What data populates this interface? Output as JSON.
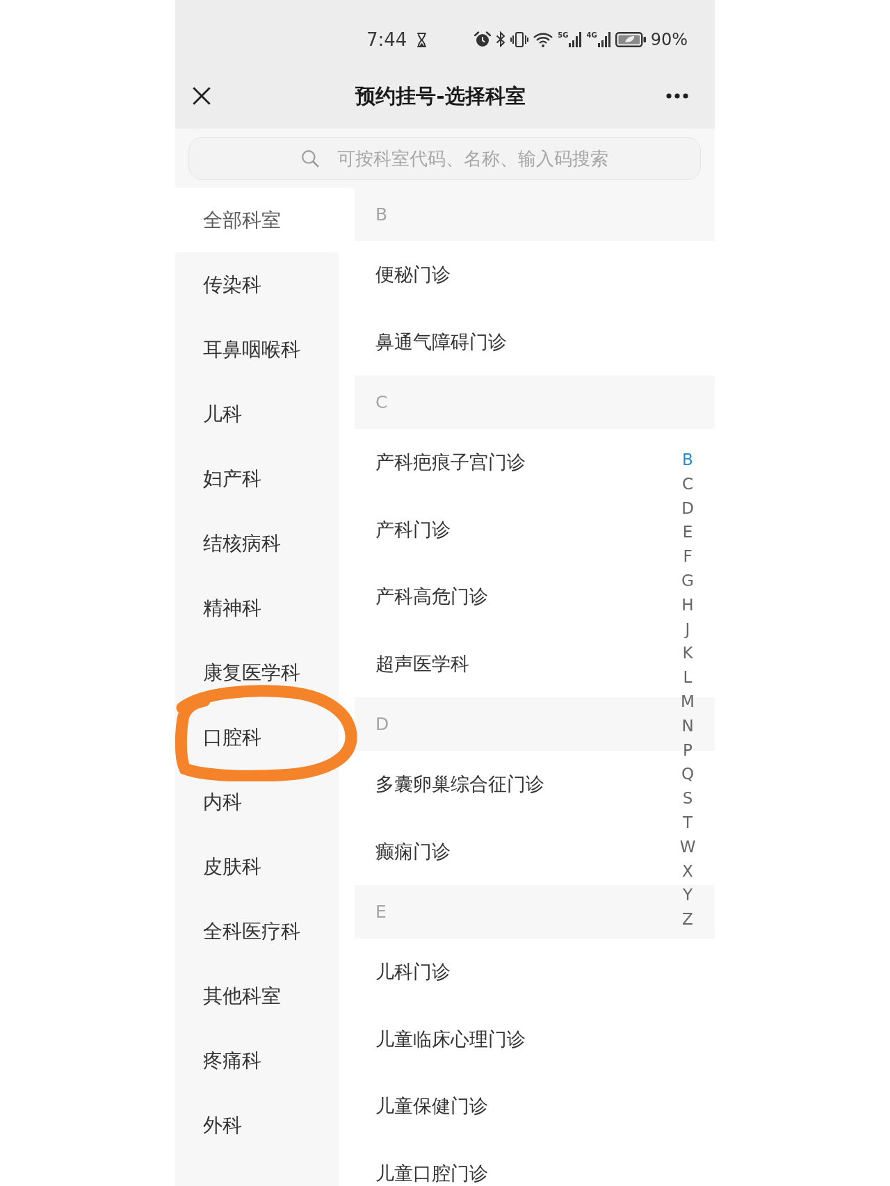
{
  "status_bar": {
    "time": "7:44",
    "signals": [
      {
        "label": "5G"
      },
      {
        "label": "4G"
      }
    ],
    "battery": "90%"
  },
  "header": {
    "title": "预约挂号-选择科室"
  },
  "search": {
    "placeholder": "可按科室代码、名称、输入码搜索"
  },
  "categories": [
    {
      "label": "全部科室",
      "selected": true,
      "circled": false
    },
    {
      "label": "传染科",
      "selected": false,
      "circled": false
    },
    {
      "label": "耳鼻咽喉科",
      "selected": false,
      "circled": false
    },
    {
      "label": "儿科",
      "selected": false,
      "circled": false
    },
    {
      "label": "妇产科",
      "selected": false,
      "circled": false
    },
    {
      "label": "结核病科",
      "selected": false,
      "circled": false
    },
    {
      "label": "精神科",
      "selected": false,
      "circled": false
    },
    {
      "label": "康复医学科",
      "selected": false,
      "circled": false
    },
    {
      "label": "口腔科",
      "selected": false,
      "circled": true
    },
    {
      "label": "内科",
      "selected": false,
      "circled": false
    },
    {
      "label": "皮肤科",
      "selected": false,
      "circled": false
    },
    {
      "label": "全科医疗科",
      "selected": false,
      "circled": false
    },
    {
      "label": "其他科室",
      "selected": false,
      "circled": false
    },
    {
      "label": "疼痛科",
      "selected": false,
      "circled": false
    },
    {
      "label": "外科",
      "selected": false,
      "circled": false
    }
  ],
  "sections": [
    {
      "letter": "B",
      "items": [
        "便秘门诊",
        "鼻通气障碍门诊"
      ]
    },
    {
      "letter": "C",
      "items": [
        "产科疤痕子宫门诊",
        "产科门诊",
        "产科高危门诊",
        "超声医学科"
      ]
    },
    {
      "letter": "D",
      "items": [
        "多囊卵巢综合征门诊",
        "癫痫门诊"
      ]
    },
    {
      "letter": "E",
      "items": [
        "儿科门诊",
        "儿童临床心理门诊",
        "儿童保健门诊",
        "儿童口腔门诊"
      ]
    }
  ],
  "index": [
    {
      "letter": "B",
      "selected": true
    },
    {
      "letter": "C",
      "selected": false
    },
    {
      "letter": "D",
      "selected": false
    },
    {
      "letter": "E",
      "selected": false
    },
    {
      "letter": "F",
      "selected": false
    },
    {
      "letter": "G",
      "selected": false
    },
    {
      "letter": "H",
      "selected": false
    },
    {
      "letter": "J",
      "selected": false
    },
    {
      "letter": "K",
      "selected": false
    },
    {
      "letter": "L",
      "selected": false
    },
    {
      "letter": "M",
      "selected": false
    },
    {
      "letter": "N",
      "selected": false
    },
    {
      "letter": "P",
      "selected": false
    },
    {
      "letter": "Q",
      "selected": false
    },
    {
      "letter": "S",
      "selected": false
    },
    {
      "letter": "T",
      "selected": false
    },
    {
      "letter": "W",
      "selected": false
    },
    {
      "letter": "X",
      "selected": false
    },
    {
      "letter": "Y",
      "selected": false
    },
    {
      "letter": "Z",
      "selected": false
    }
  ]
}
